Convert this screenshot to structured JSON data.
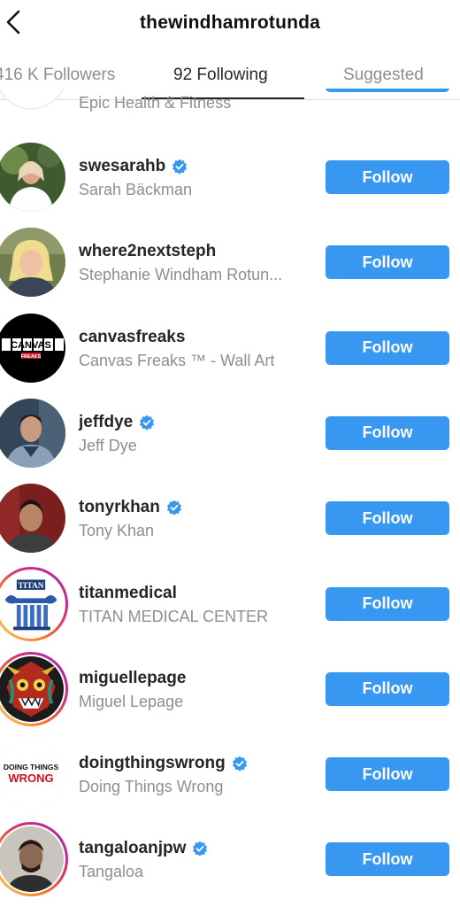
{
  "header": {
    "title": "thewindhamrotunda",
    "back_icon": "chevron-left-icon"
  },
  "tabs": [
    {
      "label": "416 K Followers",
      "active": false
    },
    {
      "label": "92 Following",
      "active": true
    },
    {
      "label": "Suggested",
      "active": false
    }
  ],
  "partial_row": {
    "full_name": "Epic Health & Fitness"
  },
  "rows": [
    {
      "username": "swesarahb",
      "full_name": "Sarah Bäckman",
      "verified": true,
      "button": "Follow"
    },
    {
      "username": "where2nextsteph",
      "full_name": "Stephanie Windham Rotun...",
      "verified": false,
      "button": "Follow"
    },
    {
      "username": "canvasfreaks",
      "full_name": "Canvas Freaks ™ - Wall Art",
      "verified": false,
      "button": "Follow",
      "avatar_text": "CANVAS",
      "avatar_subtext": "FREAKS"
    },
    {
      "username": "jeffdye",
      "full_name": "Jeff Dye",
      "verified": true,
      "button": "Follow"
    },
    {
      "username": "tonyrkhan",
      "full_name": "Tony Khan",
      "verified": true,
      "button": "Follow"
    },
    {
      "username": "titanmedical",
      "full_name": "TITAN MEDICAL CENTER",
      "verified": false,
      "button": "Follow",
      "avatar_text": "TITAN"
    },
    {
      "username": "miguellepage",
      "full_name": "Miguel Lepage",
      "verified": false,
      "button": "Follow"
    },
    {
      "username": "doingthingswrong",
      "full_name": "Doing Things Wrong",
      "verified": true,
      "button": "Follow",
      "avatar_text": "DOING THINGS",
      "avatar_subtext": "WRONG"
    },
    {
      "username": "tangaloanjpw",
      "full_name": "Tangaloa",
      "verified": true,
      "button": "Follow"
    }
  ],
  "colors": {
    "accent": "#3897f0",
    "text": "#262626",
    "secondary": "#8e8e8e",
    "story_ring": "#d6249f"
  }
}
